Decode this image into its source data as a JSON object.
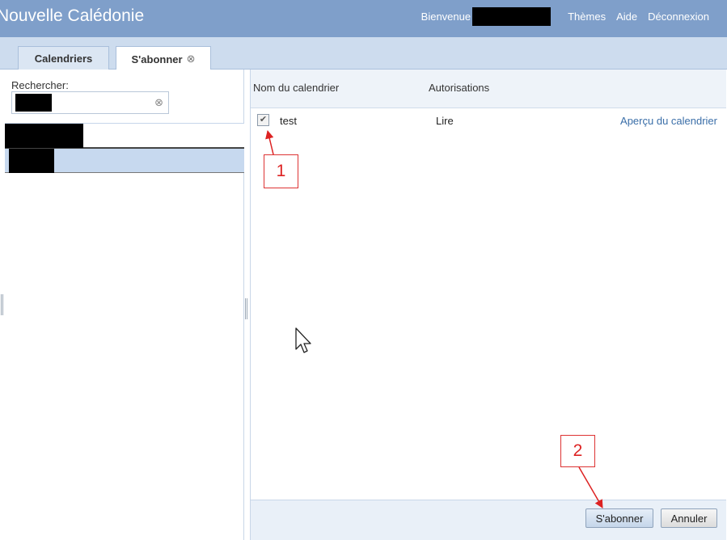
{
  "header": {
    "title": "Nouvelle Calédonie",
    "welcome": "Bienvenue",
    "nav": [
      "Thèmes",
      "Aide",
      "Déconnexion"
    ]
  },
  "tabs": [
    {
      "label": "Calendriers",
      "active": false
    },
    {
      "label": "S'abonner",
      "active": true,
      "close_icon": "⊗"
    }
  ],
  "left": {
    "search_label": "Rechercher:",
    "clear_icon": "⊗"
  },
  "table": {
    "columns": [
      "Nom du calendrier",
      "Autorisations"
    ],
    "rows": [
      {
        "checked": true,
        "check_glyph": "✔",
        "name": "test",
        "permission": "Lire",
        "link": "Aperçu du calendrier"
      }
    ]
  },
  "buttons": {
    "subscribe": "S'abonner",
    "cancel": "Annuler"
  },
  "callouts": [
    "1",
    "2"
  ],
  "colors": {
    "header_bg": "#7f9fca",
    "tabstrip_bg": "#cddcee",
    "selected_row": "#c7d9ef",
    "link": "#3a6ea8",
    "callout": "#dd2222"
  }
}
